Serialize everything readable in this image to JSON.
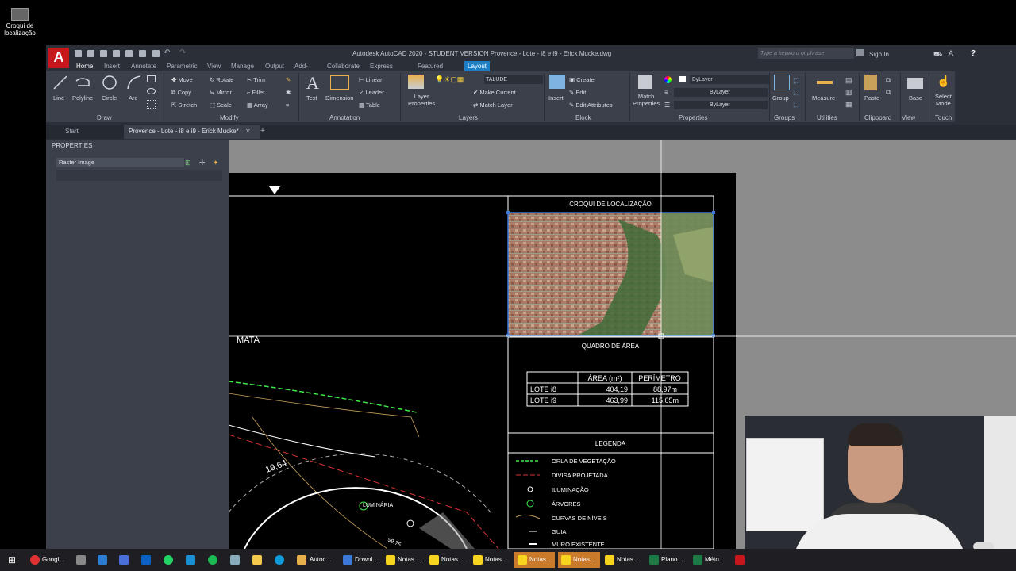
{
  "desktop": {
    "icon_label_1": "Croqui de",
    "icon_label_2": "localização"
  },
  "titlebar": {
    "title": "Autodesk AutoCAD 2020 - STUDENT VERSION    Provence - Lote - i8 e i9 - Erick Mucke.dwg",
    "search_placeholder": "Type a keyword or phrase",
    "sign_in": "Sign In",
    "logo": "A"
  },
  "tabs": [
    "Home",
    "Insert",
    "Annotate",
    "Parametric",
    "View",
    "Manage",
    "Output",
    "Add-ins",
    "Collaborate",
    "Express Tools",
    "Featured Apps",
    "Layout"
  ],
  "ribbon": {
    "draw": {
      "label": "Draw",
      "line": "Line",
      "polyline": "Polyline",
      "circle": "Circle",
      "arc": "Arc"
    },
    "modify": {
      "label": "Modify",
      "move": "Move",
      "rotate": "Rotate",
      "trim": "Trim",
      "copy": "Copy",
      "mirror": "Mirror",
      "fillet": "Fillet",
      "stretch": "Stretch",
      "scale": "Scale",
      "array": "Array"
    },
    "annotation": {
      "label": "Annotation",
      "text": "Text",
      "dimension": "Dimension",
      "linear": "Linear",
      "leader": "Leader",
      "table": "Table"
    },
    "layers": {
      "label": "Layers",
      "layer_properties_1": "Layer",
      "layer_properties_2": "Properties",
      "current_layer": "TALUDE",
      "make_current": "Make Current",
      "match_layer": "Match Layer"
    },
    "block": {
      "label": "Block",
      "insert": "Insert",
      "create": "Create",
      "edit": "Edit",
      "edit_attributes": "Edit Attributes"
    },
    "properties": {
      "label": "Properties",
      "match_1": "Match",
      "match_2": "Properties",
      "color": "ByLayer",
      "linetype": "ByLayer",
      "lineweight": "ByLayer"
    },
    "groups": {
      "label": "Groups",
      "group": "Group"
    },
    "utilities": {
      "label": "Utilities",
      "measure": "Measure"
    },
    "clipboard": {
      "label": "Clipboard",
      "paste": "Paste"
    },
    "view": {
      "label": "View",
      "base": "Base"
    },
    "touch": {
      "label": "Touch",
      "select_1": "Select",
      "select_2": "Mode"
    }
  },
  "doc_tabs": {
    "start": "Start",
    "active": "Provence - Lote - i8 e i9 - Erick Mucke*"
  },
  "properties_palette": {
    "title": "PROPERTIES",
    "selection": "Raster Image"
  },
  "drawing": {
    "croqui_title": "CROQUI DE LOCALIZAÇÃO",
    "quadro_title": "QUADRO DE ÁREA",
    "mata_label": "MATA",
    "dim_label": "19,64",
    "luminaria_label": "LUMINÁRIA",
    "dim_label_2": "99.75",
    "area_table": {
      "headers": [
        "",
        "ÁREA (m²)",
        "PERÍMETRO"
      ],
      "rows": [
        [
          "LOTE i8",
          "404,19",
          "88,97m"
        ],
        [
          "LOTE i9",
          "463,99",
          "115,05m"
        ]
      ]
    },
    "legenda_title": "LEGENDA",
    "legend": [
      "ORLA DE VEGETAÇÃO",
      "DIVISA PROJETADA",
      "ILUMINAÇÃO",
      "ÁRVORES",
      "CURVAS DE NÍVEIS",
      "GUIA",
      "MURO EXISTENTE"
    ]
  },
  "taskbar": [
    "Googl...",
    "Downl...",
    "Autoc...",
    "Notas ...",
    "Notas ...",
    "Notas ...",
    "Notas...",
    "Notas ...",
    "Notas ...",
    "Plano ...",
    "Méto..."
  ]
}
